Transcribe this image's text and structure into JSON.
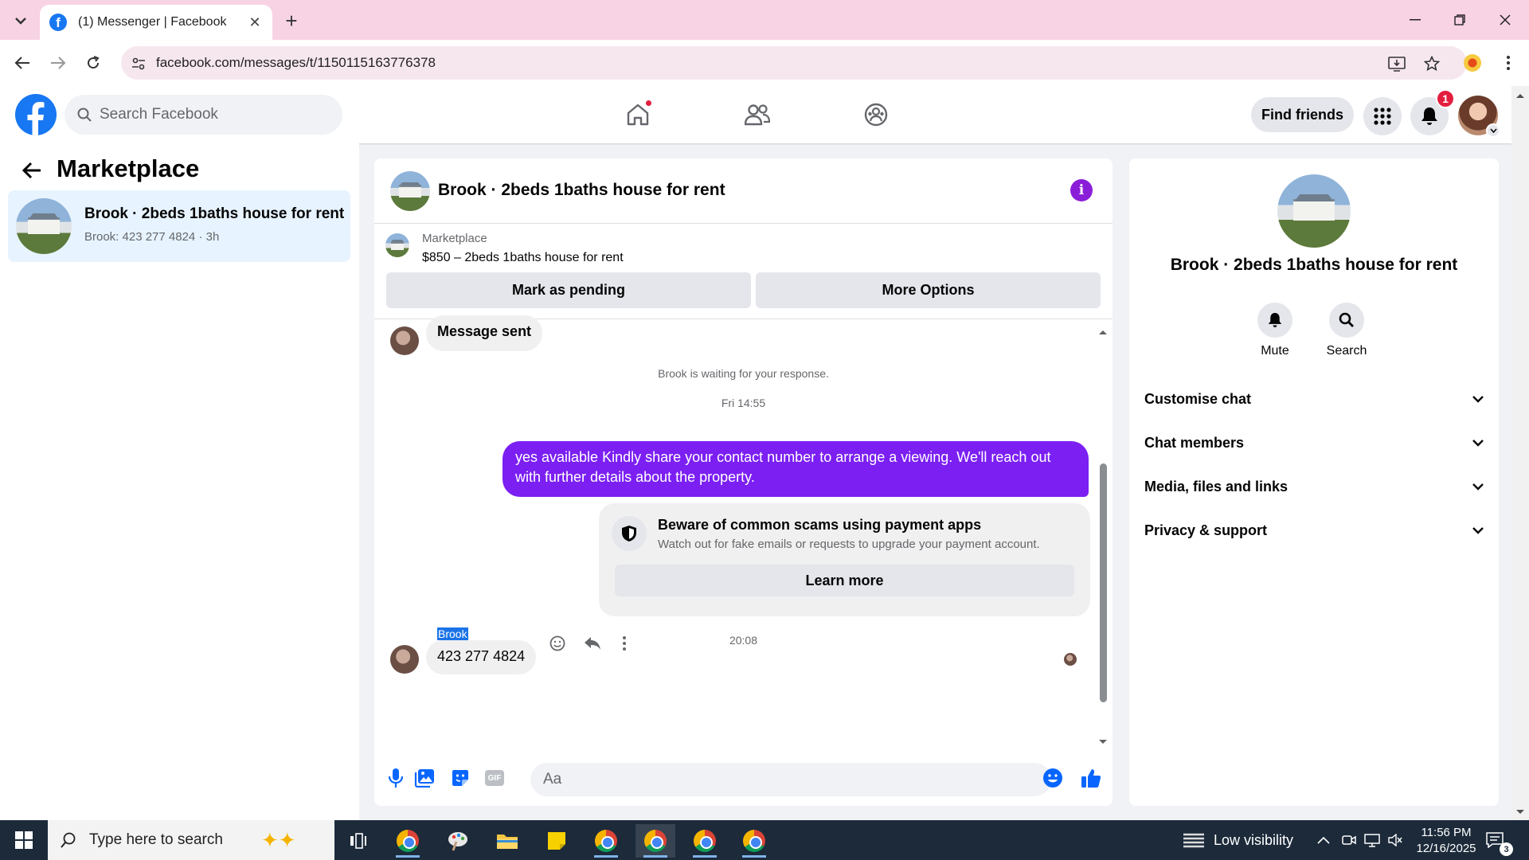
{
  "browser": {
    "tab_title": "(1) Messenger | Facebook",
    "url": "facebook.com/messages/t/1150115163776378"
  },
  "fb": {
    "search_placeholder": "Search Facebook",
    "find_friends": "Find friends",
    "notification_count": "1"
  },
  "left": {
    "title": "Marketplace",
    "conversation": {
      "title": "Brook · 2beds 1baths house for rent",
      "preview": "Brook: 423 277 4824 · 3h"
    }
  },
  "chat": {
    "header_title": "Brook · 2beds 1baths house for rent",
    "listing_source": "Marketplace",
    "listing_title": "$850 – 2beds 1baths house for rent",
    "mark_pending": "Mark as pending",
    "more_options": "More Options",
    "messages": {
      "first_received": "Message sent",
      "waiting": "Brook is waiting for your response.",
      "time1": "Fri 14:55",
      "sent": "yes available Kindly share your contact number to arrange a viewing. We'll reach out with further details about the property.",
      "scam_title": "Beware of common scams using payment apps",
      "scam_desc": "Watch out for fake emails or requests to upgrade your payment account.",
      "learn_more": "Learn more",
      "time2": "20:08",
      "sender": "Brook",
      "last_received": "423 277 4824"
    },
    "composer_placeholder": "Aa"
  },
  "right": {
    "name": "Brook · 2beds 1baths house for rent",
    "mute": "Mute",
    "search": "Search",
    "sections": [
      "Customise chat",
      "Chat members",
      "Media, files and links",
      "Privacy & support"
    ]
  },
  "taskbar": {
    "search_placeholder": "Type here to search",
    "weather": "Low visibility",
    "time": "11:56 PM",
    "date": "12/16/2025",
    "notif_count": "3"
  },
  "colors": {
    "fb_blue": "#1877f2",
    "messenger_purple": "#7b1ff2",
    "tab_bar": "#f8d3e4"
  }
}
